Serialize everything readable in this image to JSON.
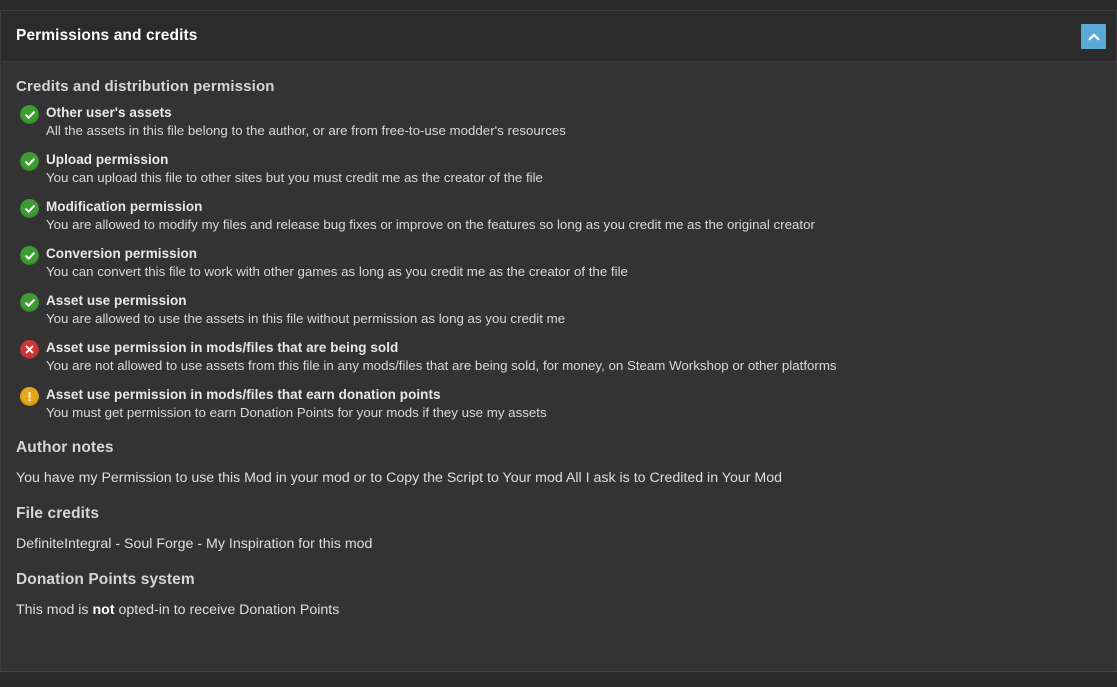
{
  "header": {
    "title": "Permissions and credits",
    "collapse_icon": "chevron-up-icon",
    "collapse_color": "#5ba9d8"
  },
  "credits_section": {
    "heading": "Credits and distribution permission",
    "permissions": [
      {
        "status": "allowed",
        "icon": "check-circle-icon",
        "color": "#3f9c35",
        "title": "Other user's assets",
        "description": "All the assets in this file belong to the author, or are from free-to-use modder's resources"
      },
      {
        "status": "allowed",
        "icon": "check-circle-icon",
        "color": "#3f9c35",
        "title": "Upload permission",
        "description": "You can upload this file to other sites but you must credit me as the creator of the file"
      },
      {
        "status": "allowed",
        "icon": "check-circle-icon",
        "color": "#3f9c35",
        "title": "Modification permission",
        "description": "You are allowed to modify my files and release bug fixes or improve on the features so long as you credit me as the original creator"
      },
      {
        "status": "allowed",
        "icon": "check-circle-icon",
        "color": "#3f9c35",
        "title": "Conversion permission",
        "description": "You can convert this file to work with other games as long as you credit me as the creator of the file"
      },
      {
        "status": "allowed",
        "icon": "check-circle-icon",
        "color": "#3f9c35",
        "title": "Asset use permission",
        "description": "You are allowed to use the assets in this file without permission as long as you credit me"
      },
      {
        "status": "denied",
        "icon": "x-circle-icon",
        "color": "#d03535",
        "title": "Asset use permission in mods/files that are being sold",
        "description": "You are not allowed to use assets from this file in any mods/files that are being sold, for money, on Steam Workshop or other platforms"
      },
      {
        "status": "warning",
        "icon": "exclamation-circle-icon",
        "color": "#e5a81c",
        "title": "Asset use permission in mods/files that earn donation points",
        "description": "You must get permission to earn Donation Points for your mods if they use my assets"
      }
    ]
  },
  "author_notes": {
    "heading": "Author notes",
    "body": "You have my Permission to use this Mod in your mod or to Copy the Script to Your mod All I ask is to Credited in Your Mod"
  },
  "file_credits": {
    "heading": "File credits",
    "body": "DefiniteIntegral - Soul Forge - My Inspiration for this mod"
  },
  "donation_points": {
    "heading": "Donation Points system",
    "body_prefix": "This mod is ",
    "body_emphasis": "not",
    "body_suffix": " opted-in to receive Donation Points"
  }
}
